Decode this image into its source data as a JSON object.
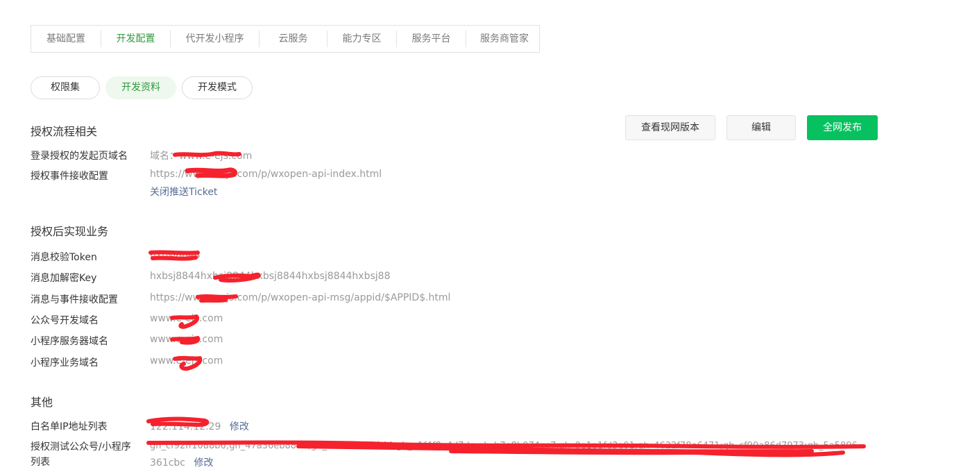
{
  "tabs": [
    {
      "label": "基础配置",
      "active": false
    },
    {
      "label": "开发配置",
      "active": true
    },
    {
      "label": "代开发小程序",
      "active": false
    },
    {
      "label": "云服务",
      "active": false
    },
    {
      "label": "能力专区",
      "active": false
    },
    {
      "label": "服务平台",
      "active": false
    },
    {
      "label": "服务商管家",
      "active": false
    }
  ],
  "pills": [
    {
      "label": "权限集",
      "active": false
    },
    {
      "label": "开发资料",
      "active": true
    },
    {
      "label": "开发模式",
      "active": false
    }
  ],
  "actions": {
    "view_live": "查看现网版本",
    "edit": "编辑",
    "publish": "全网发布"
  },
  "auth_flow": {
    "title": "授权流程相关",
    "login_domain_label": "登录授权的发起页域名",
    "login_domain_value": "域名：www.e-ejs.com",
    "event_config_label": "授权事件接收配置",
    "event_config_value": "https://www.e-ejs.com/p/wxopen-api-index.html",
    "close_ticket_link": "关闭推送Ticket"
  },
  "post_auth": {
    "title": "授权后实现业务",
    "token_label": "消息校验Token",
    "token_value": "hxbsj8844",
    "key_label": "消息加解密Key",
    "key_value": "hxbsj8844hxbsj8844hxbsj8844hxbsj8844hxbsj88",
    "msg_config_label": "消息与事件接收配置",
    "msg_config_value": "https://www.e-ejs.com/p/wxopen-api-msg/appid/$APPID$.html",
    "mp_domain_label": "公众号开发域名",
    "mp_domain_value": "www.e-ejs.com",
    "mini_server_label": "小程序服务器域名",
    "mini_server_value": "www.e-ejs.com",
    "mini_biz_label": "小程序业务域名",
    "mini_biz_value": "www.e-ejs.com"
  },
  "other": {
    "title": "其他",
    "whitelist_label": "白名单IP地址列表",
    "whitelist_value": "122.114.12.29",
    "modify_link": "修改",
    "test_accounts_label": "授权测试公众号/小程序列表",
    "test_accounts_line1": "gh_cf92ff1088b6;gh_47a36eb8853;gh_6d33f1512144;gh_a1f4f8a4d7da;gh_b7e8b074ac7,gh_0e1a1fd3e01;gh_4622f78e6471;gh_cf90a86d7973;gh_5a5896",
    "test_accounts_line2": "361cbc",
    "modify_link2": "修改"
  },
  "colors": {
    "accent_green": "#07c160",
    "active_text": "#2e9b3d",
    "link": "#576b95",
    "redaction": "#f5222d"
  }
}
